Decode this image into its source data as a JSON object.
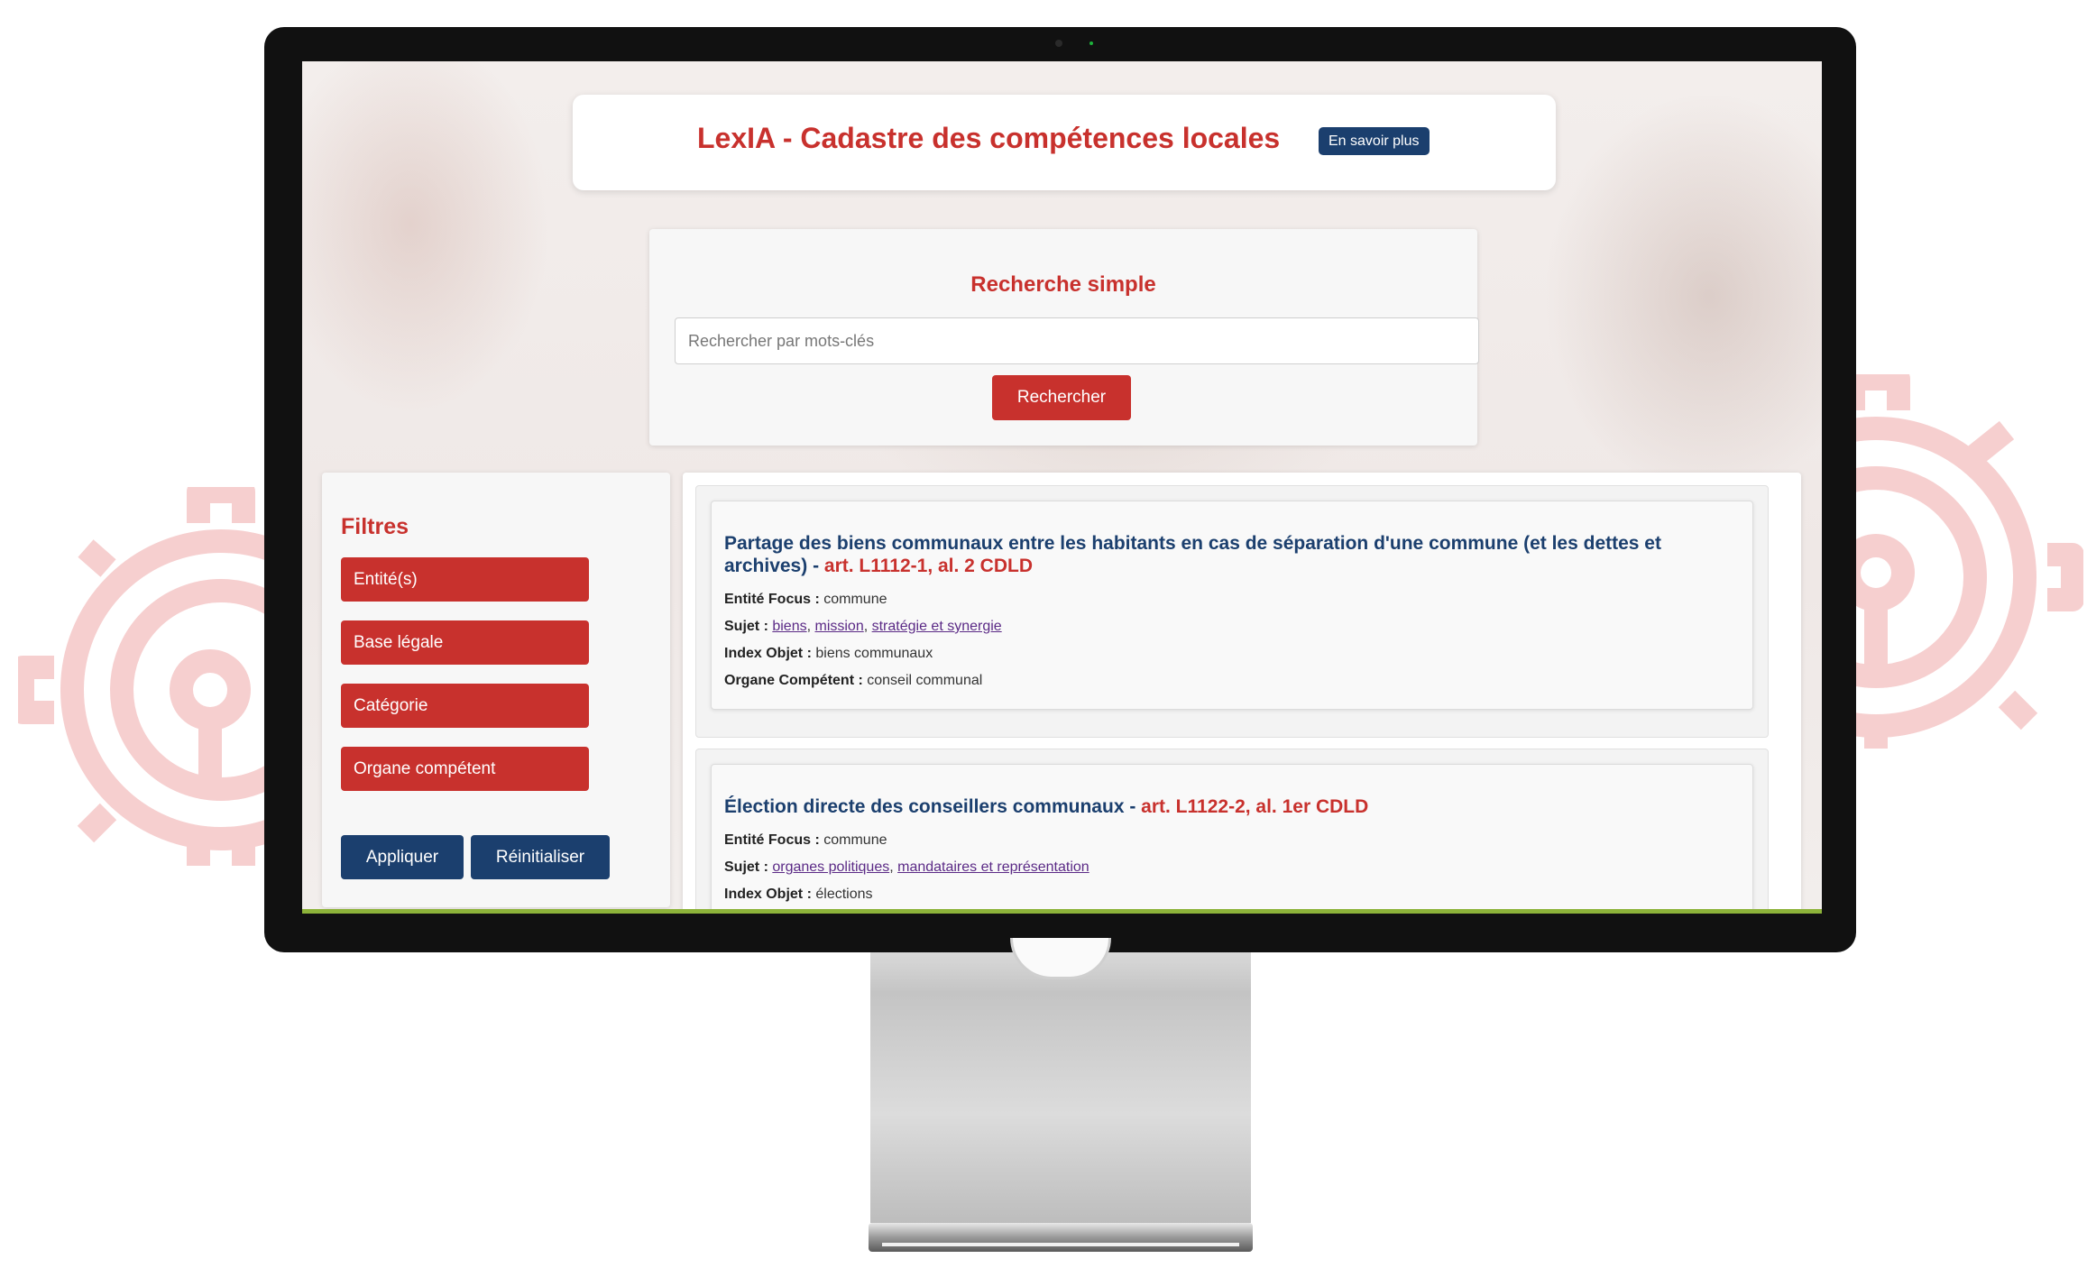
{
  "app": {
    "title": "LexIA - Cadastre des compétences locales",
    "learn_more": "En savoir plus"
  },
  "search": {
    "title": "Recherche simple",
    "placeholder": "Rechercher par mots-clés",
    "button": "Rechercher"
  },
  "filters": {
    "title": "Filtres",
    "items": [
      "Entité(s)",
      "Base légale",
      "Catégorie",
      "Organe compétent"
    ],
    "apply": "Appliquer",
    "reset": "Réinitialiser"
  },
  "labels": {
    "entity": "Entité Focus :",
    "subject": "Sujet :",
    "index": "Index Objet :",
    "organ": "Organe Compétent :"
  },
  "results": [
    {
      "title": "Partage des biens communaux entre les habitants en cas de séparation d'une commune (et les dettes et archives)",
      "separator": " - ",
      "article": "art. L1112-1, al. 2 CDLD",
      "entity": "commune",
      "subjects": [
        "biens",
        "mission",
        "stratégie et synergie"
      ],
      "index": "biens communaux",
      "organ": "conseil communal"
    },
    {
      "title": "Élection directe des conseillers communaux",
      "separator": " - ",
      "article": "art. L1122-2, al. 1er CDLD",
      "entity": "commune",
      "subjects": [
        "organes politiques",
        "mandataires et représentation"
      ],
      "index": "élections"
    }
  ],
  "colors": {
    "brand_red": "#c8312d",
    "navy": "#1b3f6e",
    "link": "#5b2a86",
    "deco_pink": "#f6cfcf",
    "accent_green": "#8db33a"
  },
  "icons": {
    "decor_left": "lightbulb-gear-icon",
    "decor_right": "lightbulb-gear-icon"
  }
}
